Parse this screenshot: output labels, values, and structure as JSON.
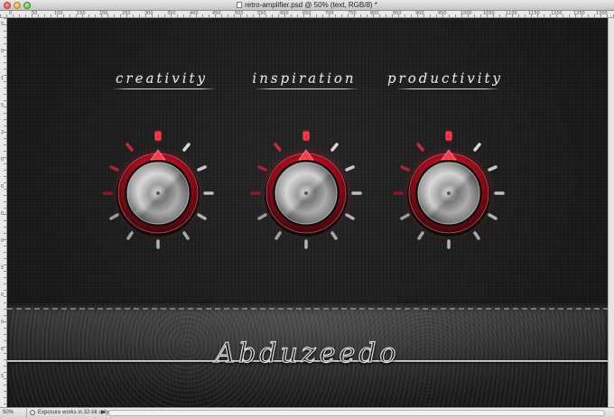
{
  "window": {
    "title": "retro-amplifier.psd @ 50% (text, RGB/8) *"
  },
  "rulers": {
    "top_marks": [
      "0",
      "50",
      "100",
      "150",
      "200",
      "250",
      "300",
      "350",
      "400",
      "450",
      "500",
      "550",
      "600",
      "650",
      "700",
      "750",
      "800",
      "850",
      "900",
      "950",
      "1000",
      "1050",
      "1100",
      "1150",
      "1200",
      "1250",
      "1300"
    ],
    "left_marks": [
      "5",
      "0",
      "1",
      "5",
      "2",
      "0",
      "0",
      "0",
      "0",
      "5",
      "0",
      "0",
      "6",
      "5"
    ]
  },
  "knobs": [
    {
      "label": "creativity"
    },
    {
      "label": "inspiration"
    },
    {
      "label": "productivity"
    }
  ],
  "brand": {
    "text": "Abduzeedo"
  },
  "status": {
    "zoom": "50%",
    "message": "Exposure works in 32-bit only",
    "arrow": "▶"
  },
  "colors": {
    "accent_red": "#d4142a",
    "metal_light": "#e2e2e2",
    "metal_dark": "#3a3a3a",
    "background": "#1c1c1c"
  }
}
